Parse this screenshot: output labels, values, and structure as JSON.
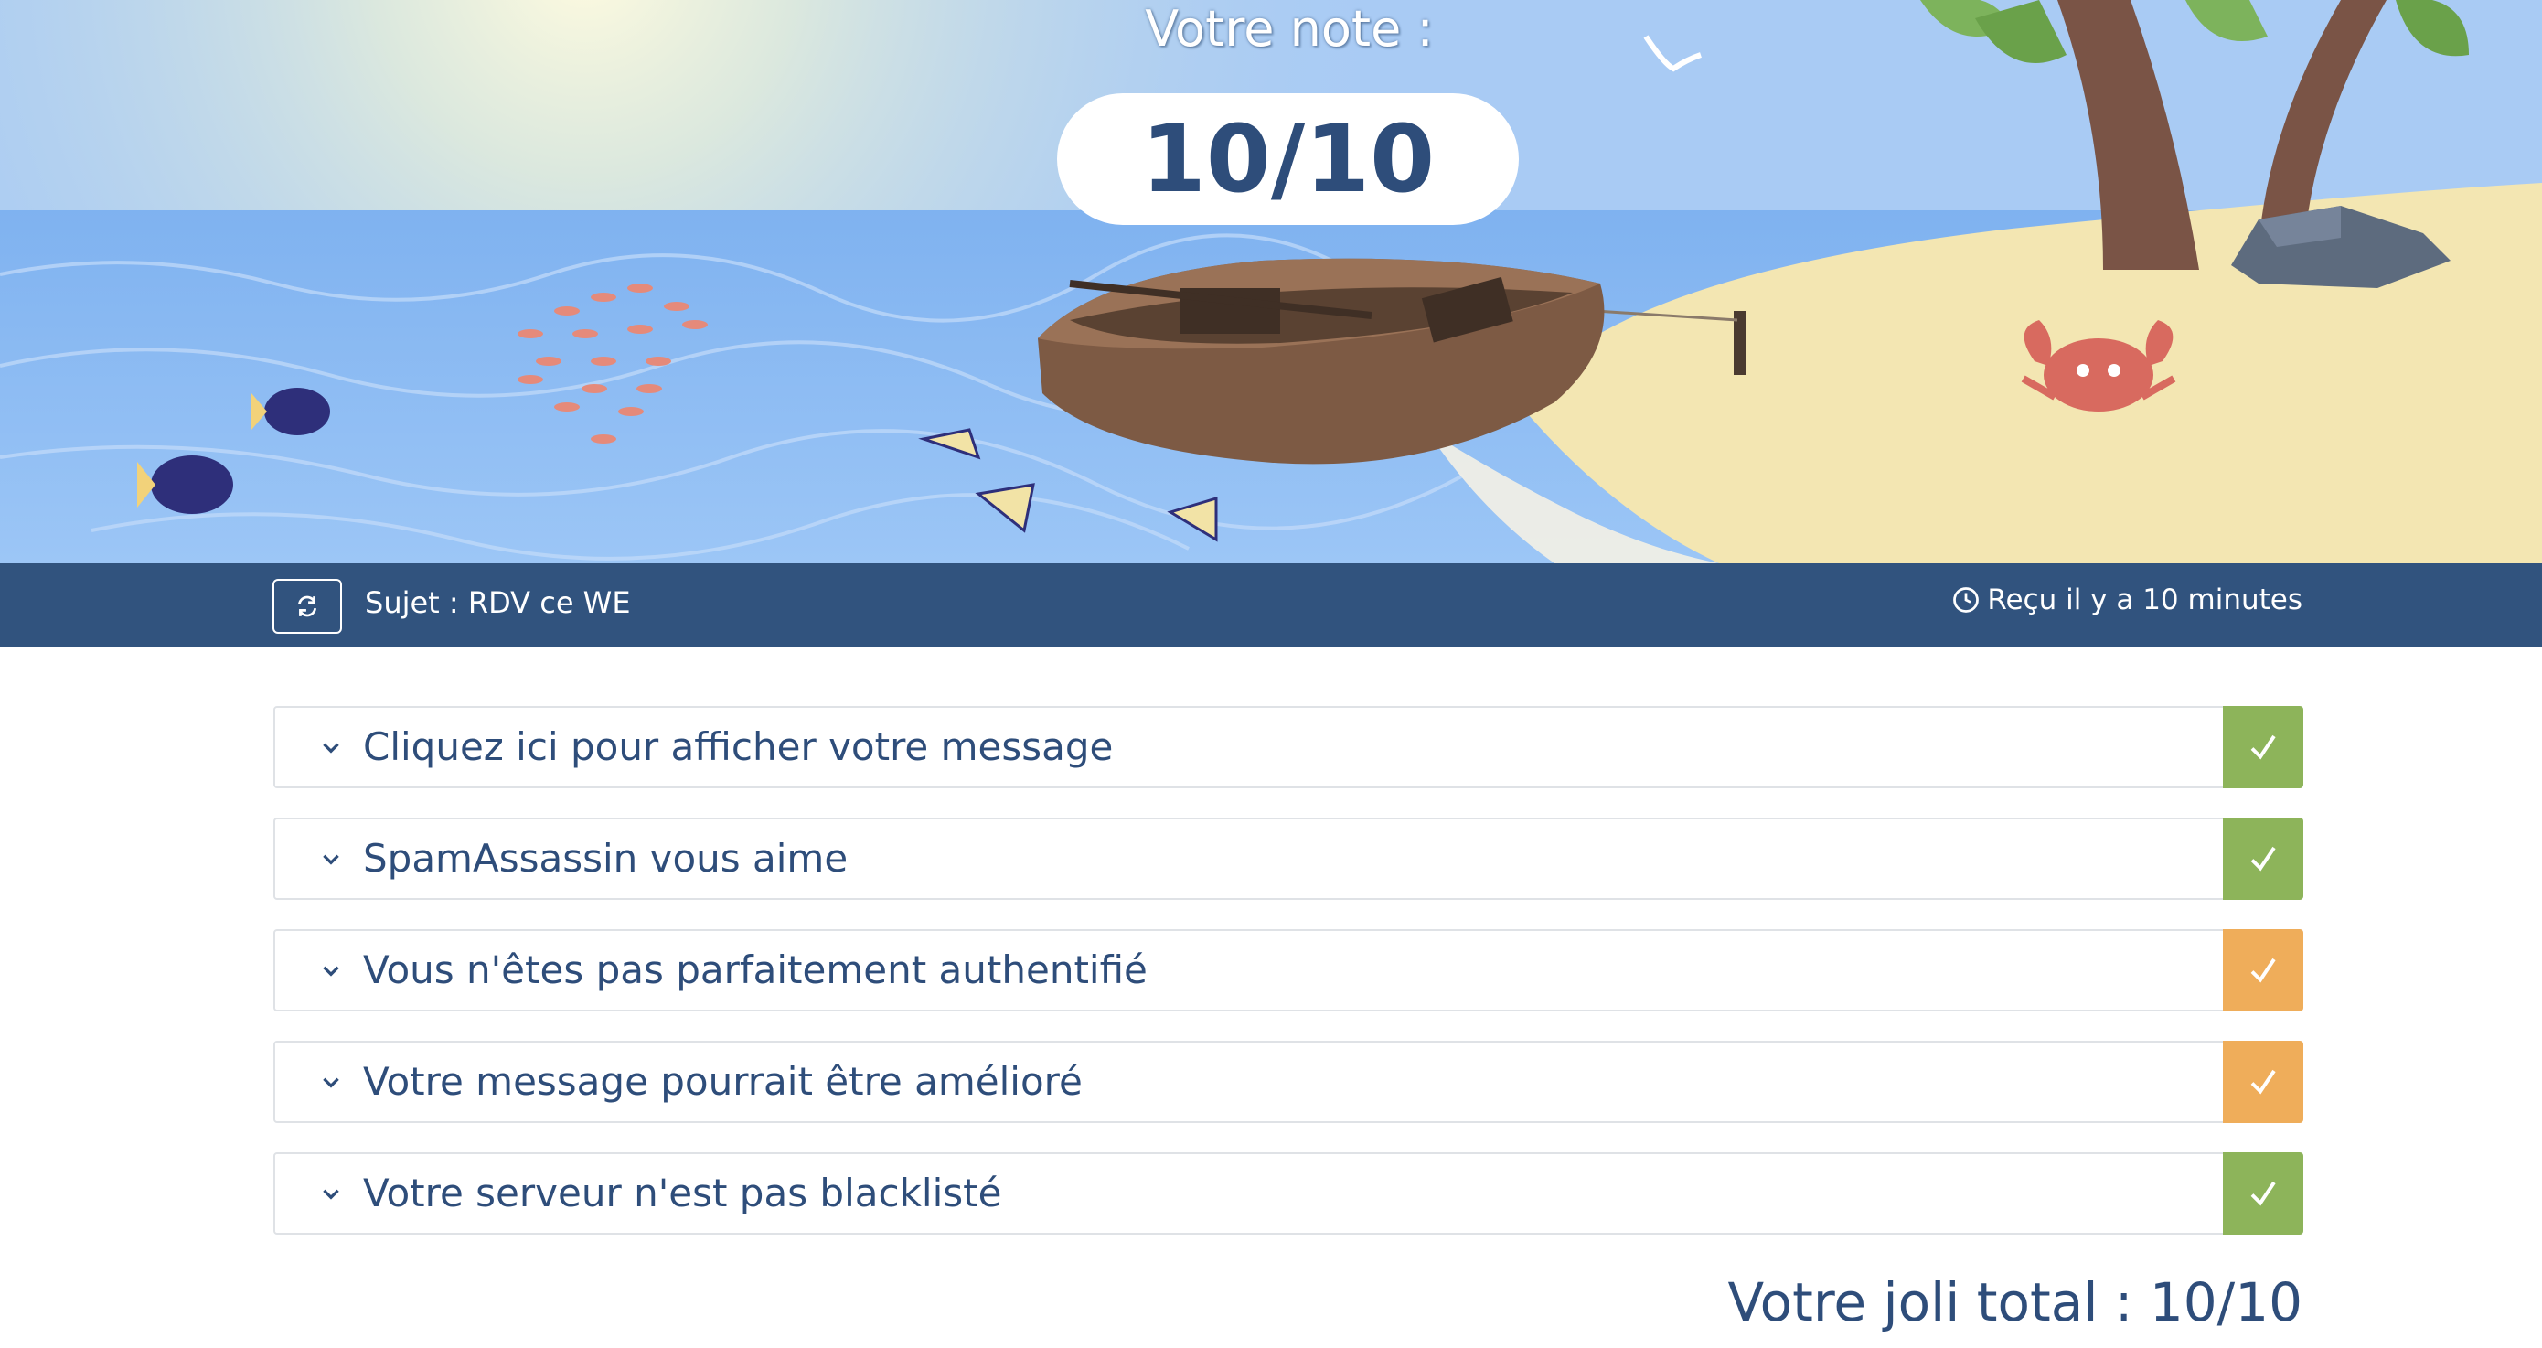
{
  "hero": {
    "score_label": "Votre note :",
    "score_value": "10/10"
  },
  "subject_bar": {
    "refresh_icon": "refresh-icon",
    "subject": "Sujet : RDV ce WE",
    "received_icon": "clock-icon",
    "received": "Reçu il y a 10 minutes"
  },
  "checks": [
    {
      "label": "Cliquez ici pour afficher votre message",
      "status": "ok",
      "status_color": "#8db45a"
    },
    {
      "label": "SpamAssassin vous aime",
      "status": "ok",
      "status_color": "#8db45a"
    },
    {
      "label": "Vous n'êtes pas parfaitement authentifié",
      "status": "warn",
      "status_color": "#efad5a"
    },
    {
      "label": "Votre message pourrait être amélioré",
      "status": "warn",
      "status_color": "#efad5a"
    },
    {
      "label": "Votre serveur n'est pas blacklisté",
      "status": "ok",
      "status_color": "#8db45a"
    }
  ],
  "total": "Votre joli total : 10/10",
  "colors": {
    "primary": "#31537e",
    "text": "#2e4d7a",
    "ok": "#8db45a",
    "warn": "#efad5a"
  }
}
